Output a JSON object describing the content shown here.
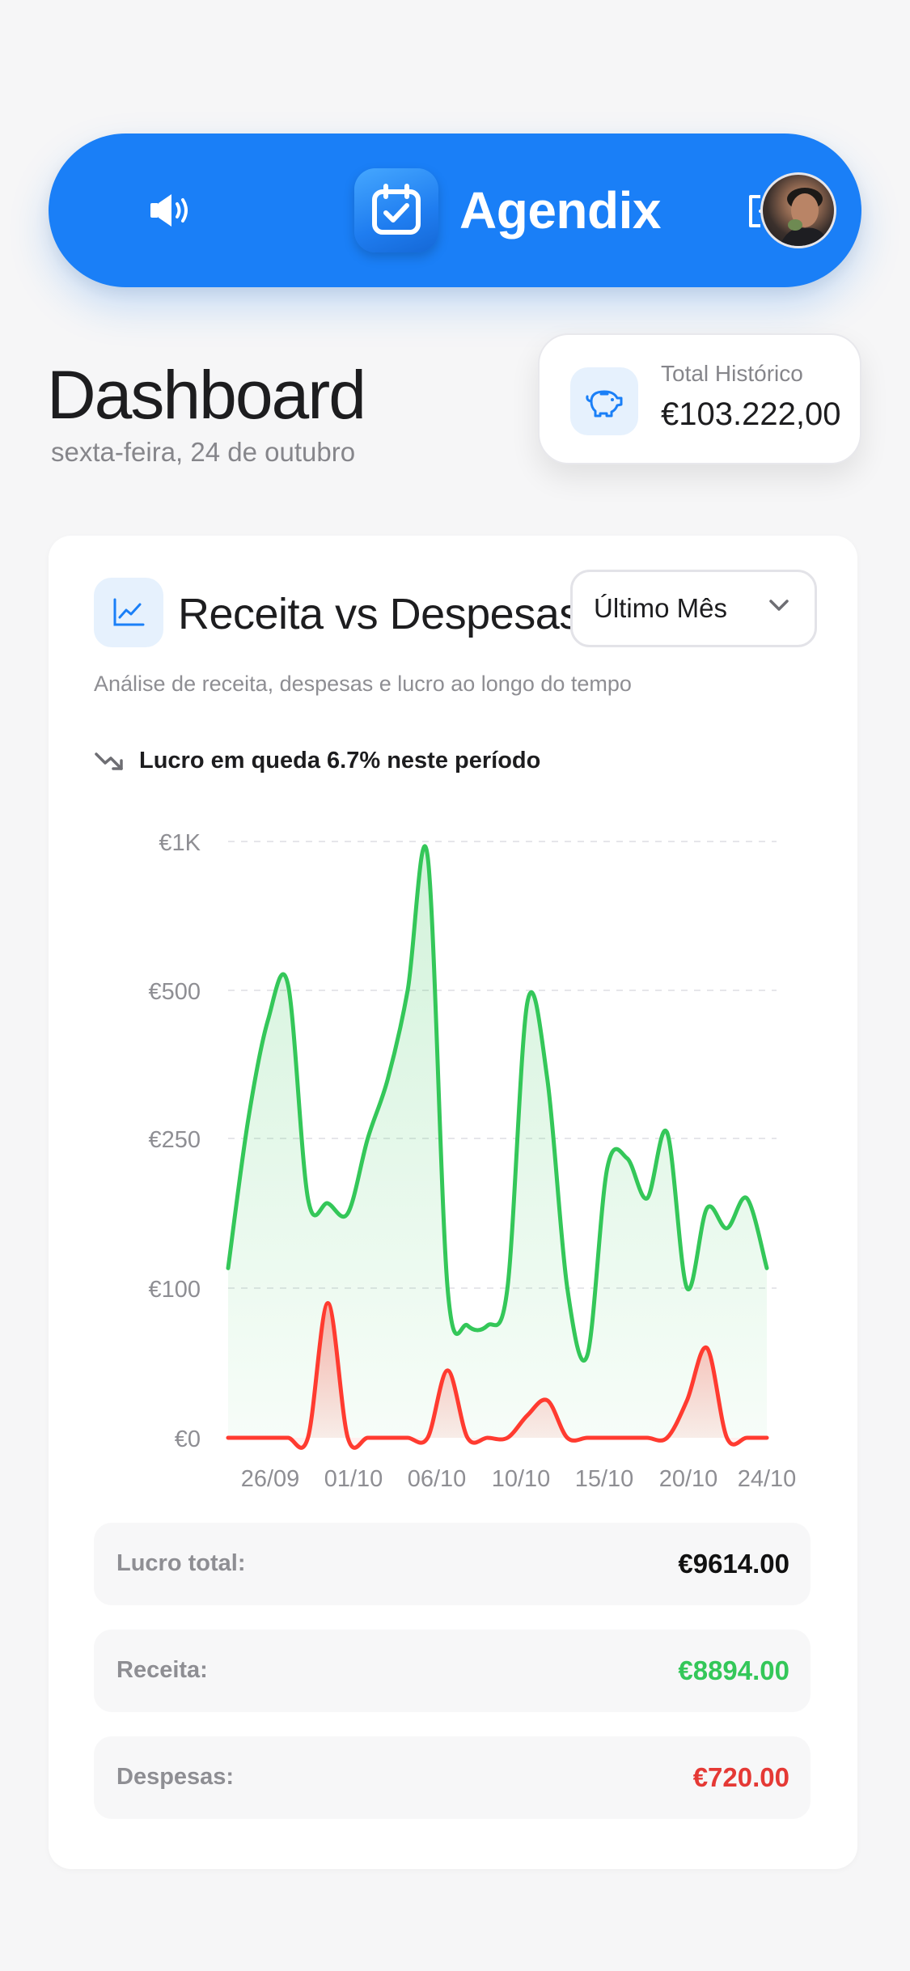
{
  "header": {
    "brand_name": "Agendix",
    "icons": {
      "sound": "speaker-icon",
      "logo": "calendar-check-icon",
      "logout": "logout-icon",
      "avatar": "user-avatar"
    },
    "colors": {
      "primary": "#1a7ff7"
    }
  },
  "page": {
    "title": "Dashboard",
    "date": "sexta-feira, 24 de outubro"
  },
  "total_card": {
    "label": "Total Histórico",
    "value": "€103.222,00",
    "icon": "piggy-bank-icon"
  },
  "chart_card": {
    "title": "Receita vs Despesas",
    "subtitle": "Análise de receita, despesas e lucro ao longo do tempo",
    "period_select": {
      "selected": "Último Mês"
    },
    "trend": {
      "icon": "trending-down-icon",
      "text": "Lucro em queda 6.7% neste período"
    }
  },
  "chart_data": {
    "type": "area",
    "y_scale": "log-like",
    "ylim": [
      0,
      1000
    ],
    "y_ticks": [
      "€0",
      "€100",
      "€250",
      "€500",
      "€1K"
    ],
    "y_tick_values": [
      0,
      100,
      250,
      500,
      1000
    ],
    "x_ticks": [
      "26/09",
      "01/10",
      "06/10",
      "10/10",
      "15/10",
      "20/10",
      "24/10"
    ],
    "grid": true,
    "series": [
      {
        "color": "#34c759",
        "points": [
          [
            0,
            120
          ],
          [
            1,
            280
          ],
          [
            2,
            450
          ],
          [
            3,
            520
          ],
          [
            4,
            190
          ],
          [
            5,
            185
          ],
          [
            6,
            175
          ],
          [
            7,
            250
          ],
          [
            8,
            350
          ],
          [
            9,
            500
          ],
          [
            10,
            950
          ],
          [
            11,
            100
          ],
          [
            12,
            75
          ],
          [
            13,
            75
          ],
          [
            14,
            100
          ],
          [
            15,
            480
          ],
          [
            16,
            350
          ],
          [
            17,
            100
          ],
          [
            18,
            55
          ],
          [
            19,
            220
          ],
          [
            20,
            230
          ],
          [
            21,
            190
          ],
          [
            22,
            260
          ],
          [
            23,
            100
          ],
          [
            24,
            180
          ],
          [
            25,
            160
          ],
          [
            26,
            190
          ],
          [
            27,
            120
          ]
        ]
      },
      {
        "color": "#ff3b30",
        "points": [
          [
            0,
            0
          ],
          [
            1,
            0
          ],
          [
            2,
            0
          ],
          [
            3,
            0
          ],
          [
            4,
            0
          ],
          [
            5,
            90
          ],
          [
            6,
            0
          ],
          [
            7,
            0
          ],
          [
            8,
            0
          ],
          [
            9,
            0
          ],
          [
            10,
            0
          ],
          [
            11,
            45
          ],
          [
            12,
            0
          ],
          [
            13,
            0
          ],
          [
            14,
            0
          ],
          [
            15,
            15
          ],
          [
            16,
            25
          ],
          [
            17,
            0
          ],
          [
            18,
            0
          ],
          [
            19,
            0
          ],
          [
            20,
            0
          ],
          [
            21,
            0
          ],
          [
            22,
            0
          ],
          [
            23,
            25
          ],
          [
            24,
            60
          ],
          [
            25,
            0
          ],
          [
            26,
            0
          ],
          [
            27,
            0
          ]
        ]
      }
    ]
  },
  "stats": [
    {
      "label": "Lucro total:",
      "value": "€9614.00",
      "color": "#111111"
    },
    {
      "label": "Receita:",
      "value": "€8894.00",
      "color": "#34c759"
    },
    {
      "label": "Despesas:",
      "value": "€720.00",
      "color": "#e53935"
    }
  ]
}
